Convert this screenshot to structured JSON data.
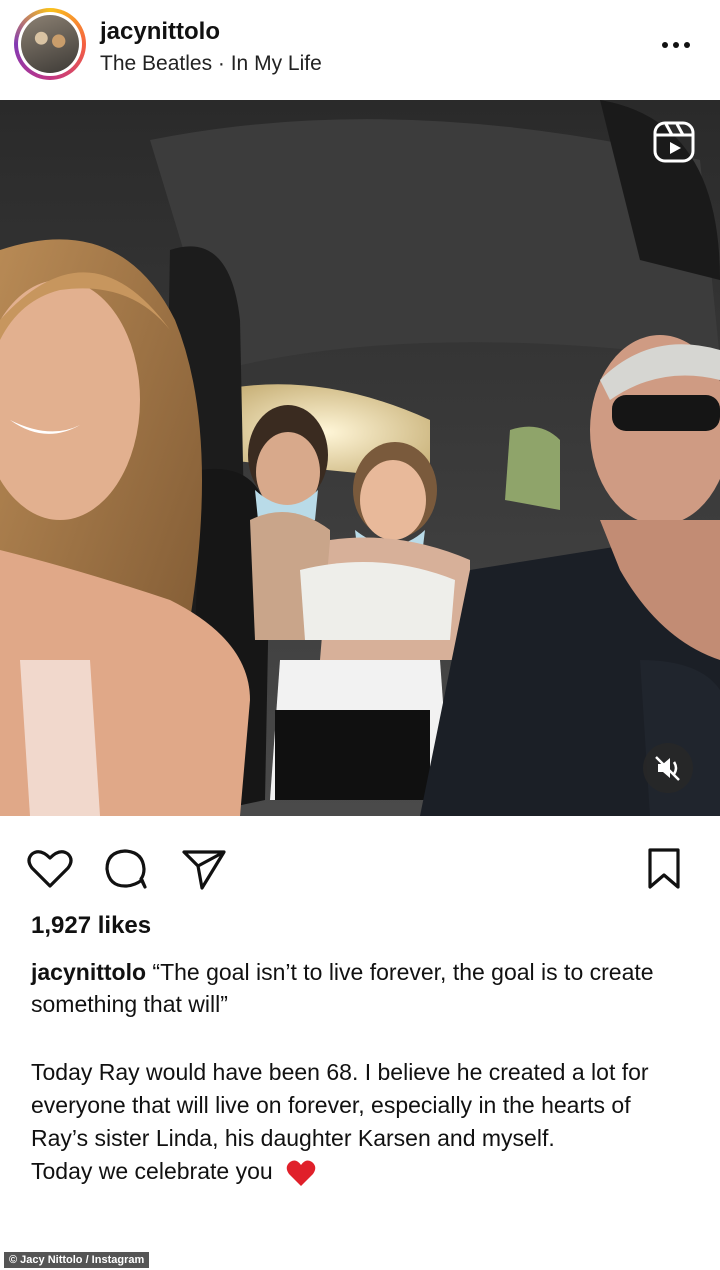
{
  "post": {
    "username": "jacynittolo",
    "audio": "The Beatles · In My Life",
    "likes": "1,927 likes",
    "caption": "“The goal isn’t to live forever, the goal is to create something that will”",
    "body_lines": [
      "Today Ray would have been 68. I believe he created a lot for everyone that will live on forever, especially in the hearts of Ray’s sister Linda, his daughter Karsen and myself.",
      "Today we celebrate you"
    ]
  },
  "icons": {
    "more": "more-options-icon",
    "reel": "reel-icon",
    "mute": "mute-icon",
    "like": "heart-icon",
    "comment": "comment-icon",
    "share": "share-icon",
    "save": "bookmark-icon",
    "celebrate": "red-heart-emoji"
  },
  "colors": {
    "heart_emoji": "#e0202a",
    "ring": "#c13584"
  },
  "credit": "© Jacy Nittolo / Instagram"
}
